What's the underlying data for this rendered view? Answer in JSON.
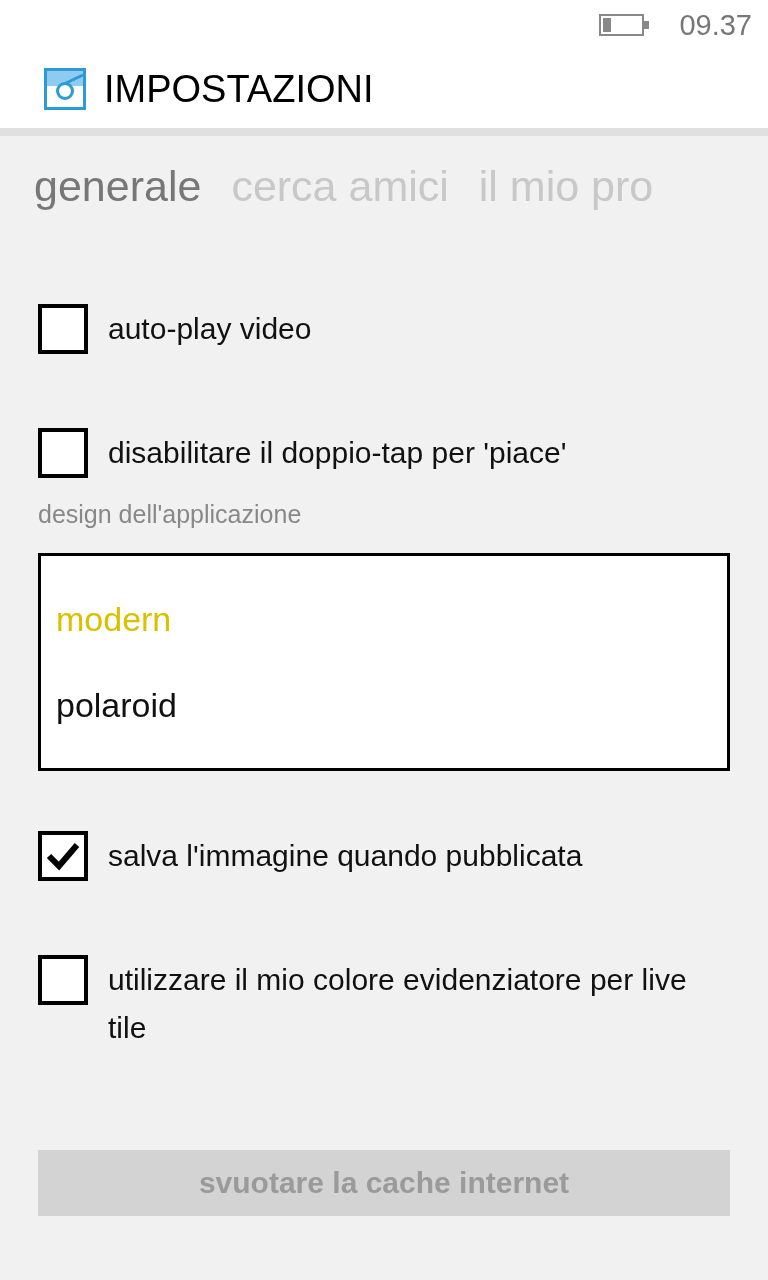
{
  "status_bar": {
    "time": "09.37"
  },
  "header": {
    "title": "IMPOSTAZIONI"
  },
  "tabs": [
    {
      "label": "generale",
      "selected": true
    },
    {
      "label": "cerca amici",
      "selected": false
    },
    {
      "label": "il mio pro",
      "selected": false
    }
  ],
  "items": [
    {
      "kind": "checkbox",
      "label": "auto-play video",
      "checked": false
    },
    {
      "kind": "checkbox",
      "label": "disabilitare il doppio-tap per 'piace'",
      "checked": false
    },
    {
      "kind": "caption",
      "label": "design dell'applicazione"
    },
    {
      "kind": "picker",
      "options": [
        {
          "label": "modern",
          "selected": true
        },
        {
          "label": "polaroid",
          "selected": false
        }
      ]
    },
    {
      "kind": "checkbox",
      "label": "salva l'immagine quando pubblicata",
      "checked": true
    },
    {
      "kind": "checkbox",
      "label": "utilizzare il mio colore evidenziatore per live tile",
      "checked": false
    },
    {
      "kind": "button",
      "label": "svuotare la cache internet",
      "disabled": true
    }
  ]
}
